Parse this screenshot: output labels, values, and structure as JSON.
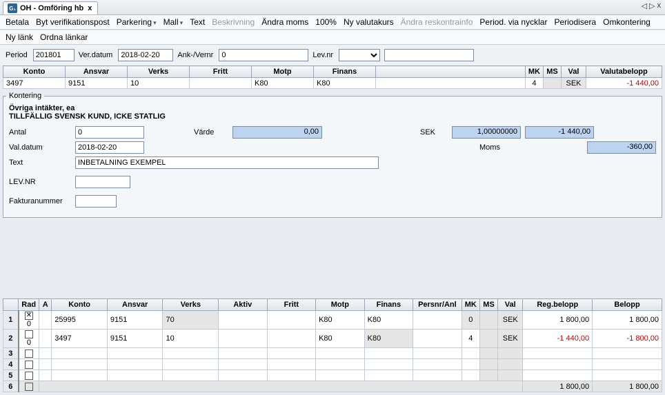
{
  "tab": {
    "icon": "G₁",
    "title": "OH - Omföring hb"
  },
  "nav": {
    "prev": "◁",
    "next": "▷",
    "close": "x"
  },
  "toolbar": [
    {
      "label": "Betala",
      "disabled": false
    },
    {
      "label": "Byt verifikationspost",
      "disabled": false
    },
    {
      "label": "Parkering",
      "dd": true
    },
    {
      "label": "Mall",
      "dd": true
    },
    {
      "label": "Text"
    },
    {
      "label": "Beskrivning",
      "disabled": true
    },
    {
      "label": "Ändra moms"
    },
    {
      "label": "100%"
    },
    {
      "label": "Ny valutakurs"
    },
    {
      "label": "Ändra reskontrainfo",
      "disabled": true
    },
    {
      "label": "Period. via nycklar"
    },
    {
      "label": "Periodisera"
    },
    {
      "label": "Omkontering"
    }
  ],
  "toolbar2": [
    {
      "label": "Ny länk"
    },
    {
      "label": "Ordna länkar"
    }
  ],
  "form": {
    "period_lbl": "Period",
    "period": "201801",
    "verdatum_lbl": "Ver.datum",
    "verdatum": "2018-02-20",
    "ank_lbl": "Ank-/Vernr",
    "ank": "0",
    "lev_lbl": "Lev.nr",
    "lev": ""
  },
  "header_cols": [
    "Konto",
    "Ansvar",
    "Verks",
    "Fritt",
    "Motp",
    "Finans",
    "",
    "MK",
    "MS",
    "Val",
    "Valutabelopp"
  ],
  "header_row": {
    "konto": "3497",
    "ansvar": "9151",
    "verks": "10",
    "fritt": "",
    "motp": "K80",
    "finans": "K80",
    "blank": "",
    "mk": "4",
    "ms": "",
    "val": "SEK",
    "belopp": "-1 440,00"
  },
  "kont": {
    "legend": "Kontering",
    "line1": "Övriga intäkter, ea",
    "line2": "TILLFÄLLIG SVENSK KUND, ICKE STATLIG",
    "antal_lbl": "Antal",
    "antal": "0",
    "varde_lbl": "Värde",
    "varde": "0,00",
    "sek_lbl": "SEK",
    "rate": "1,00000000",
    "sek_amt": "-1 440,00",
    "valdatum_lbl": "Val.datum",
    "valdatum": "2018-02-20",
    "moms_lbl": "Moms",
    "moms": "-360,00",
    "text_lbl": "Text",
    "text": "INBETALNING EXEMPEL",
    "levnr_lbl": "LEV.NR",
    "faknr_lbl": "Fakturanummer"
  },
  "lower_cols": [
    "",
    "Rad",
    "A",
    "Konto",
    "Ansvar",
    "Verks",
    "Aktiv",
    "Fritt",
    "Motp",
    "Finans",
    "Persnr/Anl",
    "MK",
    "MS",
    "Val",
    "Reg.belopp",
    "Belopp"
  ],
  "lower_rows": [
    {
      "n": "1",
      "chk": true,
      "rad": "0",
      "a": "",
      "konto": "25995",
      "ansvar": "9151",
      "verks": "70",
      "aktiv": "",
      "fritt": "",
      "motp": "K80",
      "finans": "K80",
      "pers": "",
      "mk": "0",
      "ms": "",
      "val": "SEK",
      "reg": "1 800,00",
      "bel": "1 800,00",
      "neg": false,
      "hl": true
    },
    {
      "n": "2",
      "chk": false,
      "rad": "0",
      "a": "",
      "konto": "3497",
      "ansvar": "9151",
      "verks": "10",
      "aktiv": "",
      "fritt": "",
      "motp": "K80",
      "finans": "K80",
      "pers": "",
      "mk": "4",
      "ms": "",
      "val": "SEK",
      "reg": "-1 440,00",
      "bel": "-1 800,00",
      "neg": true,
      "finhl": true
    },
    {
      "n": "3",
      "chk": false
    },
    {
      "n": "4",
      "chk": false
    },
    {
      "n": "5",
      "chk": false
    }
  ],
  "totals": {
    "n": "6",
    "reg": "1 800,00",
    "bel": "1 800,00"
  }
}
